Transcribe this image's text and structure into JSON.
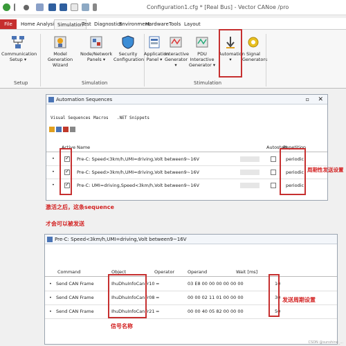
{
  "window_title": "Configuration1.cfg * [Real Bus] - Vector CANoe /pro",
  "menu_tabs": [
    "File",
    "Home",
    "Analysis",
    "Simulation",
    "Test",
    "Diagnostics",
    "Environment",
    "Hardware",
    "Tools",
    "Layout"
  ],
  "ribbon": {
    "setup": {
      "label": "Setup",
      "communication_setup": "Communication\nSetup ▾"
    },
    "simulation": {
      "label": "Simulation",
      "model_generation_wizard": "Model Generation\nWizard",
      "node_network_panels": "Node/Network\nPanels ▾",
      "security_configuration": "Security\nConfiguration"
    },
    "stimulation": {
      "label": "Stimulation",
      "application_panel": "Application\nPanel ▾",
      "interactive_generator": "Interactive\nGenerator ▾",
      "pdu_interactive_generator": "PDU Interactive\nGenerator ▾",
      "automation": "Automation\n▾",
      "signal_generators": "Signal\nGenerators"
    }
  },
  "automation_window": {
    "title": "Automation Sequences",
    "tabs": [
      "Visual Sequences",
      "Macros",
      ".NET Snippets"
    ],
    "columns": [
      "Active",
      "Name",
      "Autostart",
      "Repetition"
    ],
    "rows": [
      {
        "name": "Pre-C: Speed<3km/h,UMI=driving,Volt between9~16V",
        "repetition": "periodic"
      },
      {
        "name": "Pre-C: Speed>3km/h,UMI=driving,Volt between9~16V",
        "repetition": "periodic"
      },
      {
        "name": "Pre-C: UMI=driving,Speed<3km/h,Volt between9~16V",
        "repetition": "periodic"
      }
    ]
  },
  "sequence_window": {
    "title": "Pre-C: Speed<3km/h,UMI=driving,Volt between9~16V",
    "columns": [
      "Command",
      "Object",
      "Operator",
      "Operand",
      "Wait [ms]"
    ],
    "rows": [
      {
        "command": "Send CAN Frame",
        "object": "IhuDhuInfoCanFr10",
        "operator": "=",
        "operand": "03 E8 00 00 00 00 00 00",
        "wait": "10"
      },
      {
        "command": "Send CAN Frame",
        "object": "IhuDhuInfoCanFr08",
        "operator": "=",
        "operand": "00 00 02 11 01 00 00 00",
        "wait": "30"
      },
      {
        "command": "Send CAN Frame",
        "object": "IhuDhuInfoCanFr21",
        "operator": "=",
        "operand": "00 00 40 05 82 00 00 00",
        "wait": "50"
      }
    ]
  },
  "annotations": {
    "periodic": "周期性发送设置",
    "activate": "激活之后，这条sequence",
    "activate2": "才会可以被发送",
    "period": "发送周期设置",
    "signal_name": "信号名称"
  },
  "watermark": "CSDN @sunshine_..."
}
